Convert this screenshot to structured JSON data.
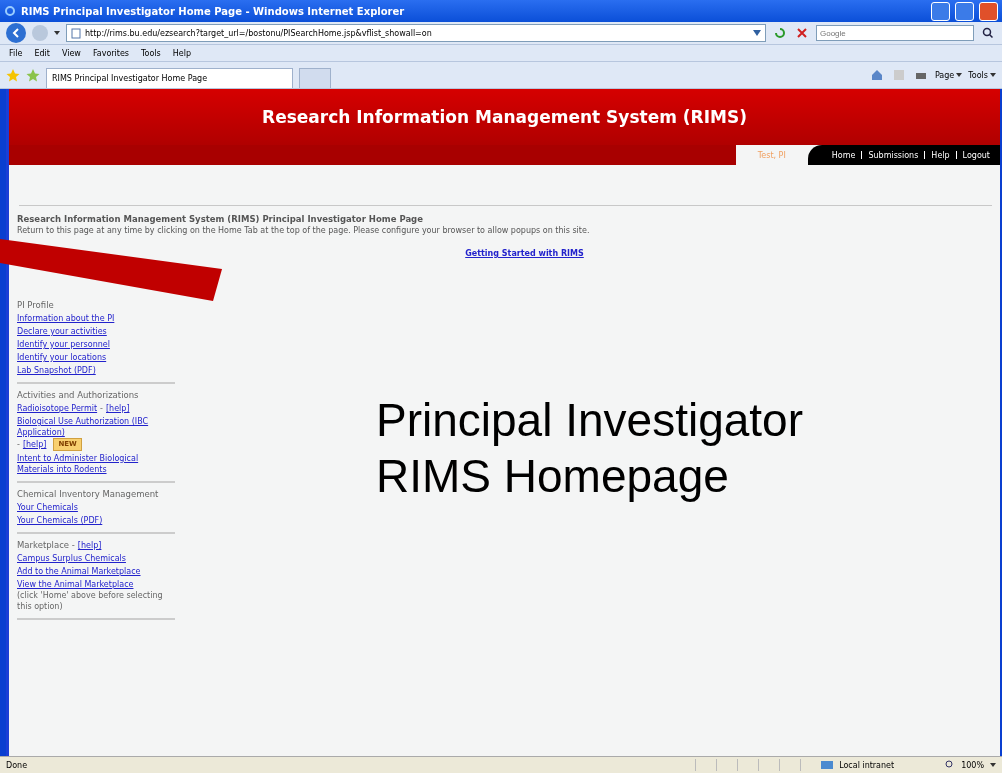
{
  "window": {
    "title": "RIMS Principal Investigator Home Page - Windows Internet Explorer"
  },
  "address_bar": {
    "url": "http://rims.bu.edu/ezsearch?target_url=/bostonu/PISearchHome.jsp&vflist_showall=on",
    "search_placeholder": "Google"
  },
  "menu": [
    "File",
    "Edit",
    "View",
    "Favorites",
    "Tools",
    "Help"
  ],
  "tabs": [
    {
      "label": "RIMS Principal Investigator Home Page",
      "selected": true
    }
  ],
  "command_bar": [
    "Page",
    "Tools"
  ],
  "page": {
    "header": "Research Information Management System (RIMS)",
    "user": "Test, PI",
    "nav": [
      "Home",
      "Submissions",
      "Help",
      "Logout"
    ],
    "heading": "Research Information Management System (RIMS) Principal Investigator Home Page",
    "intro": "Return to this page at any time by clicking on the Home Tab at the top of the page. Please configure your browser to allow popups on this site.",
    "getting_started": "Getting Started with RIMS",
    "sections": [
      {
        "heading": [
          {
            "kind": "plain",
            "text": "PI Profile"
          }
        ],
        "items": [
          [
            {
              "kind": "link",
              "text": "Information about the PI"
            }
          ],
          [
            {
              "kind": "link",
              "text": "Declare your activities"
            }
          ],
          [
            {
              "kind": "link",
              "text": "Identify your personnel"
            }
          ],
          [
            {
              "kind": "link",
              "text": "Identify your locations"
            }
          ],
          [
            {
              "kind": "link",
              "text": "Lab Snapshot (PDF)"
            }
          ]
        ]
      },
      {
        "heading": [
          {
            "kind": "plain",
            "text": "Activities and Authorizations"
          }
        ],
        "items": [
          [
            {
              "kind": "link",
              "text": "Radioisotope Permit"
            },
            {
              "kind": "plain",
              "text": "-"
            },
            {
              "kind": "link",
              "text": "[help]"
            }
          ],
          [
            {
              "kind": "link",
              "text": "Biological Use Authorization (IBC Application)"
            },
            {
              "kind": "plain",
              "text": "-"
            },
            {
              "kind": "link",
              "text": "[help]"
            },
            {
              "kind": "badge",
              "text": "NEW"
            }
          ],
          [
            {
              "kind": "link",
              "text": "Intent to Administer Biological Materials into Rodents"
            }
          ]
        ]
      },
      {
        "heading": [
          {
            "kind": "plain",
            "text": "Chemical Inventory Management"
          }
        ],
        "items": [
          [
            {
              "kind": "link",
              "text": "Your Chemicals"
            }
          ],
          [
            {
              "kind": "link",
              "text": "Your Chemicals (PDF)"
            }
          ]
        ]
      },
      {
        "heading": [
          {
            "kind": "plain",
            "text": "Marketplace -"
          },
          {
            "kind": "link",
            "text": "[help]"
          }
        ],
        "items": [
          [
            {
              "kind": "link",
              "text": "Campus Surplus Chemicals"
            }
          ],
          [
            {
              "kind": "link",
              "text": "Add to the Animal Marketplace"
            }
          ],
          [
            {
              "kind": "link",
              "text": "View the Animal Marketplace"
            },
            {
              "kind": "plain",
              "text": "(click 'Home' above before selecting this option)"
            }
          ]
        ]
      }
    ]
  },
  "overlay": {
    "caption": "Principal Investigator RIMS Homepage"
  },
  "status_bar": {
    "status": "Done",
    "zone": "Local intranet",
    "zoom": "100%"
  }
}
